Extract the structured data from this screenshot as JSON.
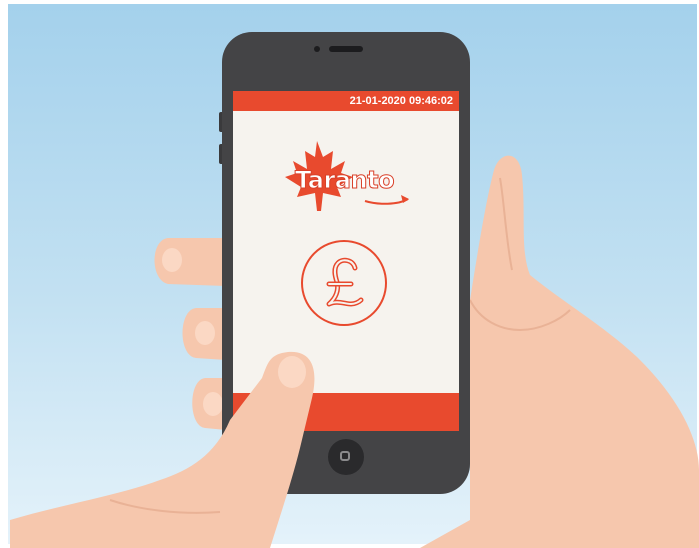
{
  "screen": {
    "timestamp": "21-01-2020 09:46:02",
    "logo_text": "Taranto",
    "currency_symbol": "£"
  },
  "icons": {
    "logo": "maple-leaf-icon",
    "currency": "pound-icon",
    "home": "home-button-icon"
  },
  "colors": {
    "accent": "#e84a2e",
    "phone_body": "#444446",
    "screen_bg": "#f6f3ee",
    "sky_top": "#a4d1ec",
    "skin": "#f6c7ad"
  }
}
